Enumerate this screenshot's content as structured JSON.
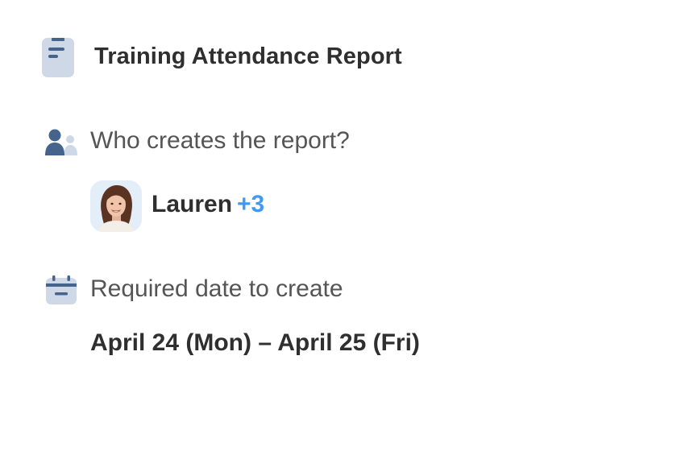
{
  "report": {
    "title": "Training Attendance Report"
  },
  "creator_section": {
    "question": "Who creates the report?",
    "assignee_name": "Lauren",
    "additional_count": "+3"
  },
  "date_section": {
    "question": "Required date to create",
    "range": "April 24 (Mon) – April 25 (Fri)"
  },
  "icons": {
    "header": "document-icon",
    "creator": "people-icon",
    "date": "calendar-icon"
  },
  "colors": {
    "icon_dark": "#45648c",
    "icon_light": "#ced8e6",
    "accent_blue": "#3f9af6",
    "text_primary": "#2f2f2f",
    "text_secondary": "#555555"
  }
}
